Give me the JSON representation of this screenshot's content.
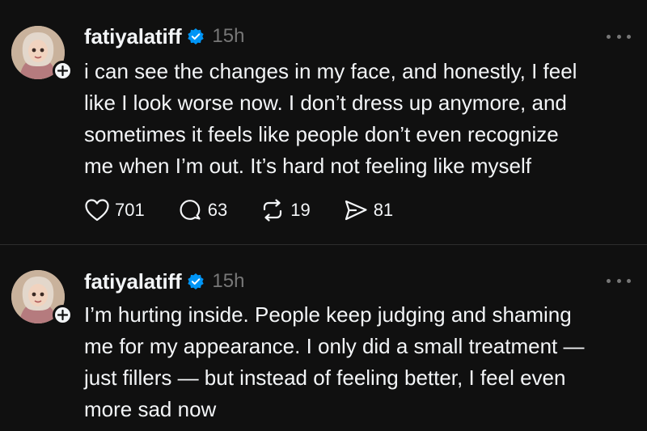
{
  "posts": [
    {
      "username": "fatiyalatiff",
      "time": "15h",
      "text": "i can see the changes in my face, and honestly, I feel\nlike I look worse now. I don’t dress up anymore, and\nsometimes it feels like people don’t even recognize\nme when I’m out. It’s hard not feeling like myself",
      "likes": "701",
      "replies": "63",
      "reposts": "19",
      "shares": "81"
    },
    {
      "username": "fatiyalatiff",
      "time": "15h",
      "text": "I’m hurting inside. People keep judging and shaming\nme for my appearance. I only did a small treatment —\njust fillers — but instead of feeling better, I feel even\nmore sad now"
    }
  ],
  "colors": {
    "background": "#101010",
    "text": "#f3f5f7",
    "muted": "#777777",
    "verified": "#0095f6",
    "divider": "#2d2d2d"
  },
  "icons": [
    "heart-icon",
    "reply-icon",
    "repost-icon",
    "share-icon",
    "verified-badge-icon",
    "plus-icon",
    "more-icon"
  ]
}
